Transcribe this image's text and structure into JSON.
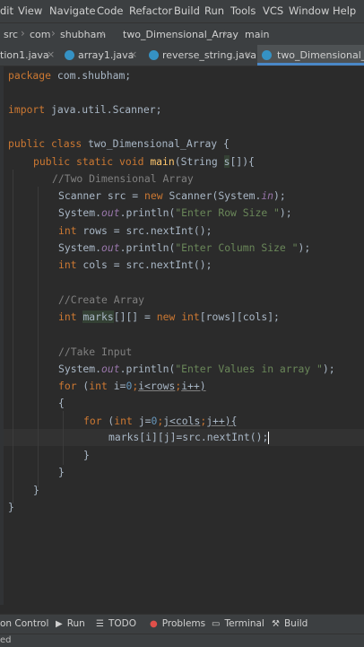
{
  "menu": [
    "dit",
    "View",
    "Navigate",
    "Code",
    "Refactor",
    "Build",
    "Run",
    "Tools",
    "VCS",
    "Window",
    "Help"
  ],
  "breadcrumb": {
    "src": "src",
    "com": "com",
    "pkg": "shubham",
    "cls": "two_Dimensional_Array",
    "method": "main"
  },
  "tabs": [
    {
      "label": "tion1.java",
      "close": "×"
    },
    {
      "label": "array1.java",
      "close": "×"
    },
    {
      "label": "reverse_string.java",
      "close": "×"
    },
    {
      "label": "two_Dimensional_Array",
      "close": ""
    }
  ],
  "code": {
    "package_kw": "package",
    "package_name": " com.shubham;",
    "import_kw": "import",
    "import_name": " java.util.Scanner;",
    "class_kw": "public class",
    "class_name": " two_Dimensional_Array {",
    "main_kw": "public static void",
    "main_fn": "main",
    "main_args_a": "(String ",
    "main_args_s": "s",
    "main_args_b": "[]){",
    "c1": "//Two Dimensional Array",
    "scanner_a": "Scanner src = ",
    "scanner_new": "new",
    "scanner_b": " Scanner(System.",
    "scanner_in": "in",
    "scanner_c": ");",
    "sys": "System.",
    "out": "out",
    "println": ".println(",
    "str_row": "\"Enter Row Size \"",
    "str_col": "\"Enter Column Size \"",
    "str_vals": "\"Enter Values in array \"",
    "close_paren": ");",
    "int_kw": "int",
    "rows_a": " rows = src.nextInt();",
    "cols_a": " cols = src.nextInt();",
    "c2": "//Create Array",
    "marks": "marks",
    "marks_b": "[][] = ",
    "new_kw": "new",
    "int2": "int",
    "marks_c": "[rows][cols];",
    "c3": "//Take Input",
    "for_kw": "for",
    "for1_a": " (",
    "for1_int": "int",
    "for1_i": " i=",
    "zero": "0",
    ";": ";",
    "for1_b": "i<rows",
    ";2": ";",
    "for1_c": "i++)",
    "brace_open": "{",
    "for2_a": " (",
    "for2_b": " j=",
    "for2_c": "j<cols",
    "for2_d": "j++){",
    "inner": "marks[i][j]=src.nextInt();",
    "brace_close": "}"
  },
  "toolwindows": {
    "control": "on Control",
    "run": "Run",
    "todo": "TODO",
    "problems": "Problems",
    "terminal": "Terminal",
    "build": "Build"
  },
  "status": "ed",
  "colors": {
    "keyword": "#cc7832",
    "comment": "#808080",
    "string": "#6a8759",
    "method": "#ffc66d",
    "field": "#9876aa",
    "number": "#6897bb",
    "text": "#a9b7c6",
    "background": "#2b2b2b"
  }
}
